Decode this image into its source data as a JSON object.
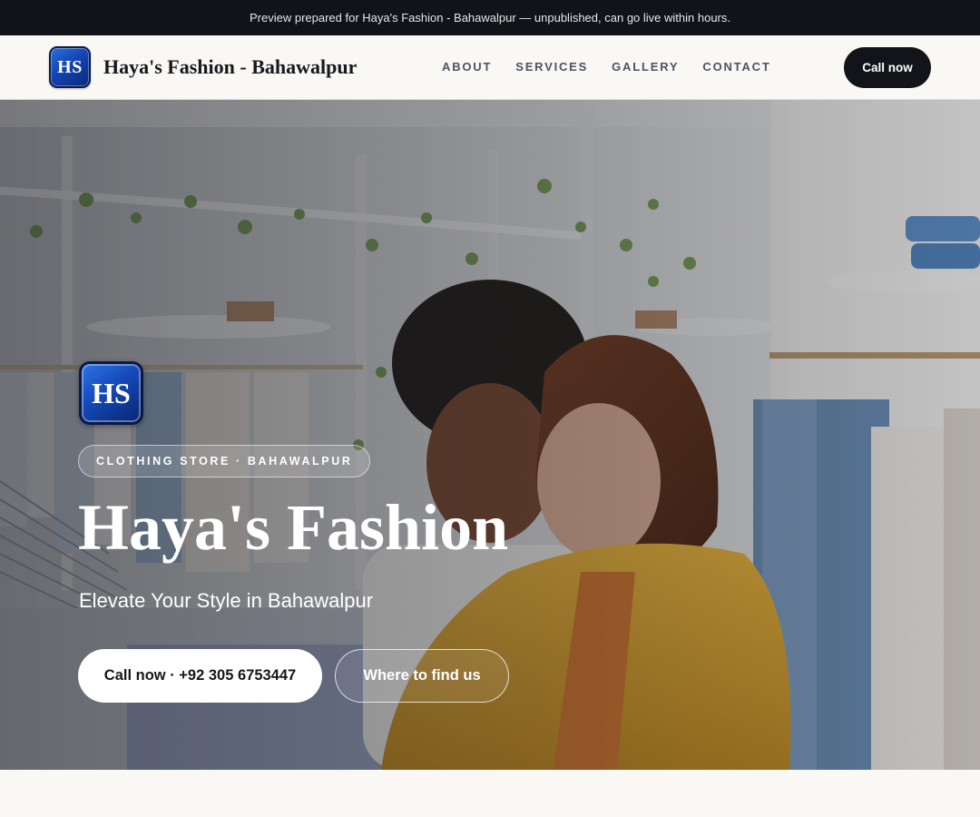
{
  "preview_banner": "Preview prepared for Haya's Fashion - Bahawalpur — unpublished, can go live within hours.",
  "nav": {
    "logo_text": "HS",
    "brand": "Haya's Fashion - Bahawalpur",
    "links": [
      "ABOUT",
      "SERVICES",
      "GALLERY",
      "CONTACT"
    ],
    "cta": "Call now"
  },
  "hero": {
    "logo_text": "HS",
    "tag": "CLOTHING STORE · BAHAWALPUR",
    "title": "Haya's Fashion",
    "subtitle": "Elevate Your Style in Bahawalpur",
    "primary_button": "Call now · +92 305 6753447",
    "secondary_button": "Where to find us"
  },
  "colors": {
    "topbar_bg": "#111318",
    "nav_bg": "#f9f8f5",
    "dark_button": "#121419",
    "logo_blue": "#1548b6",
    "blazer_yellow": "#e2a92d"
  }
}
